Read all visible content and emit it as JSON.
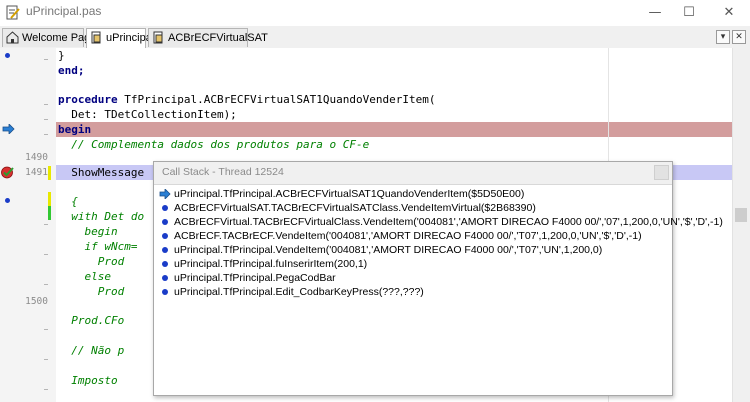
{
  "window": {
    "title": "uPrincipal.pas",
    "minimize": "—",
    "maximize": "☐",
    "close": "✕"
  },
  "tabs": [
    {
      "label": "Welcome Page",
      "icon": "welcome-page-icon",
      "active": false
    },
    {
      "label": "uPrincipal",
      "icon": "unit-file-icon",
      "active": true
    },
    {
      "label": "ACBrECFVirtualSAT",
      "icon": "unit-file-icon",
      "active": false
    }
  ],
  "tab_controls": {
    "dropdown": "▾",
    "close": "✕"
  },
  "gutter": {
    "line_numbers": [
      "1490",
      "1491",
      "1500"
    ]
  },
  "code": {
    "l1": "}",
    "l2": "end;",
    "l3_kw": "procedure",
    "l3_rest": " TfPrincipal.ACBrECFVirtualSAT1QuandoVenderItem(",
    "l4": "  Det: TDetCollectionItem);",
    "l5": "begin",
    "l6": "  // Complementa dados dos produtos para o CF-e",
    "l7": "  ShowMessage",
    "l8": "  {",
    "l9_kw": "  with",
    "l9_rest": " Det do",
    "l10": "    begin",
    "l11_kw": "    if",
    "l11_rest": " wNcm=",
    "l12": "      Prod",
    "l13": "    else",
    "l14": "      Prod",
    "l15": "  Prod.CFo",
    "l16": "  // Não p",
    "l17": "  Imposto"
  },
  "call_stack": {
    "title": "Call Stack - Thread 12524",
    "entries": [
      "uPrincipal.TfPrincipal.ACBrECFVirtualSAT1QuandoVenderItem($5D50E00)",
      "ACBrECFVirtualSAT.TACBrECFVirtualSATClass.VendeItemVirtual($2B68390)",
      "ACBrECFVirtual.TACBrECFVirtualClass.VendeItem('004081','AMORT DIRECAO F4000 00/','07',1,200,0,'UN','$','D',-1)",
      "ACBrECF.TACBrECF.VendeItem('004081','AMORT DIRECAO F4000 00/','T07',1,200,0,'UN','$','D',-1)",
      "uPrincipal.TfPrincipal.VendeItem('004081','AMORT DIRECAO F4000 00/','T07','UN',1,200,0)",
      "uPrincipal.TfPrincipal.fuInserirItem(200,1)",
      "uPrincipal.TfPrincipal.PegaCodBar",
      "uPrincipal.TfPrincipal.Edit_CodbarKeyPress(???,???)"
    ]
  },
  "colors": {
    "execution_line": "#d39d9d",
    "breakpoint_line": "#c8c8f5",
    "keyword": "#000080",
    "comment": "#008000",
    "bullet": "#1a3cc8"
  }
}
